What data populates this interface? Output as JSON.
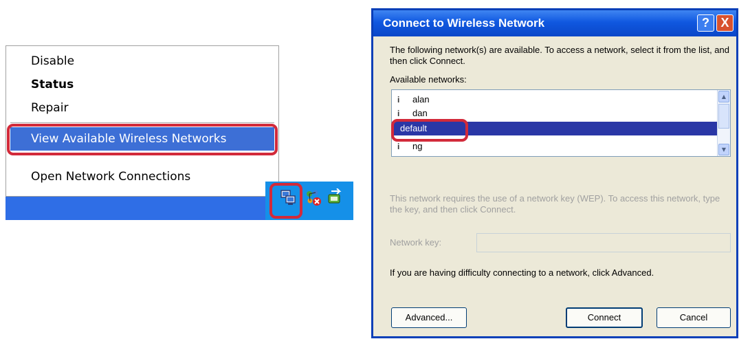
{
  "context_menu": {
    "items": [
      {
        "label": "Disable"
      },
      {
        "label": "Status"
      },
      {
        "label": "Repair"
      },
      {
        "label": "View Available Wireless Networks"
      },
      {
        "label": "Open Network Connections"
      }
    ]
  },
  "tray": {
    "icons": [
      "network-connection-icon",
      "disconnected-network-icon",
      "safely-remove-hardware-icon"
    ]
  },
  "dialog": {
    "title": "Connect to Wireless Network",
    "help_button": "?",
    "close_button": "X",
    "intro": "The following network(s) are available. To access a network, select it from the list, and then click Connect.",
    "available_label": "Available networks:",
    "networks": [
      {
        "name": "alan"
      },
      {
        "name": "dan"
      },
      {
        "name": "default",
        "selected": true
      },
      {
        "name": "ng"
      }
    ],
    "key_info": "This network requires the use of a network key (WEP). To access this network, type the key, and then click Connect.",
    "key_label": "Network key:",
    "key_value": "",
    "help_text": "If you are having difficulty connecting to a network, click Advanced.",
    "buttons": {
      "advanced": "Advanced...",
      "connect": "Connect",
      "cancel": "Cancel"
    }
  },
  "colors": {
    "highlight_ring": "#d22a3a",
    "menu_highlight": "#3d6fd6",
    "selection": "#2a37a6",
    "titlebar": "#0a46c8"
  }
}
